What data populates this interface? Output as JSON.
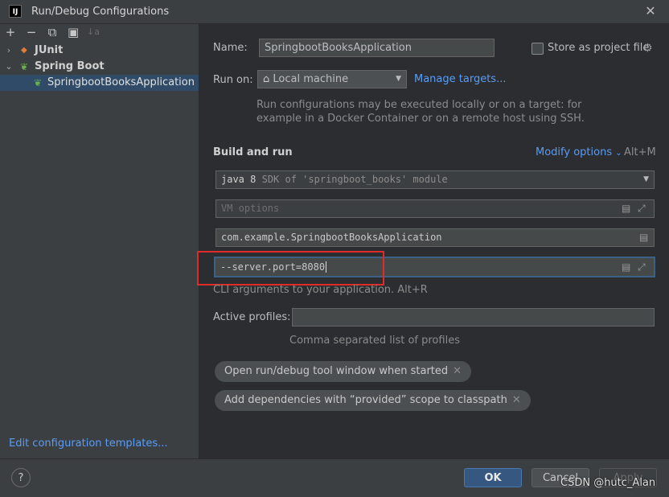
{
  "window": {
    "title": "Run/Debug Configurations",
    "app_icon_text": "IJ"
  },
  "toolbar": {
    "add": "+",
    "remove": "−",
    "copy": "⧉",
    "folder": "▣",
    "sort": "↓a"
  },
  "tree": {
    "junit": "JUnit",
    "spring_boot": "Spring Boot",
    "selected_config": "SpringbootBooksApplication"
  },
  "edit_templates_link": "Edit configuration templates...",
  "form": {
    "name_label": "Name:",
    "name_value": "SpringbootBooksApplication",
    "store_label": "Store as project file",
    "run_on_label": "Run on:",
    "run_on_value": "Local machine",
    "manage_targets": "Manage targets...",
    "run_on_hint_1": "Run configurations may be executed locally or on a target: for",
    "run_on_hint_2": "example in a Docker Container or on a remote host using SSH.",
    "build_run_title": "Build and run",
    "modify_options": "Modify options",
    "modify_shortcut": "Alt+M",
    "sdk_value": "java 8",
    "sdk_hint": "SDK of 'springboot_books' module",
    "vm_placeholder": "VM options",
    "main_class": "com.example.SpringbootBooksApplication",
    "program_args": "--server.port=8080",
    "cli_hint": "CLI arguments to your application. Alt+R",
    "profiles_label": "Active profiles:",
    "profiles_value": "",
    "profiles_hint": "Comma separated list of profiles"
  },
  "chips": [
    "Open run/debug tool window when started",
    "Add dependencies with “provided” scope to classpath"
  ],
  "buttons": {
    "help": "?",
    "ok": "OK",
    "cancel": "Cancel",
    "apply": "Apply"
  },
  "watermark": "CSDN @hutc_Alan",
  "colors": {
    "link": "#589df6",
    "selection": "#2f4b67",
    "highlight_box": "#e02b2b",
    "primary_button": "#365880"
  }
}
